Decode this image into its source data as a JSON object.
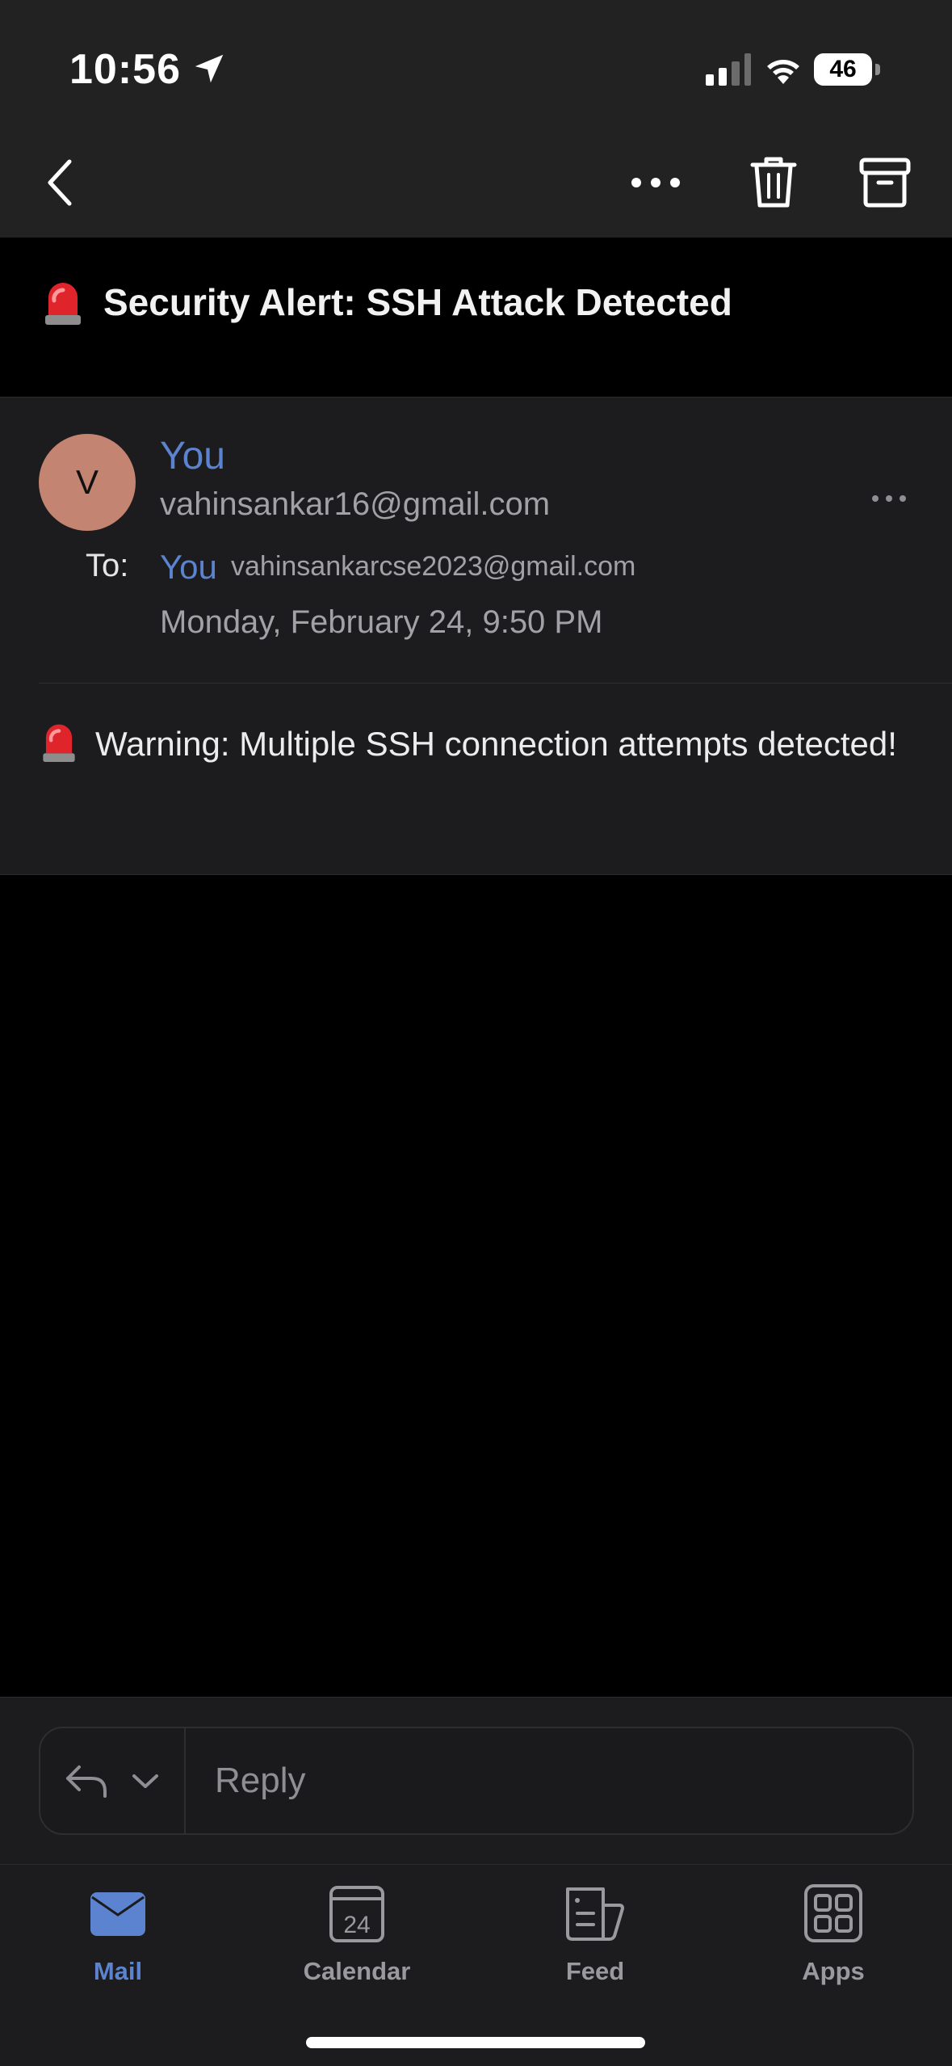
{
  "status_bar": {
    "time": "10:56",
    "battery": "46",
    "location_icon": "location-arrow-icon",
    "signal_icon": "cellular-signal-icon",
    "wifi_icon": "wifi-icon"
  },
  "nav": {
    "back_icon": "chevron-left-icon",
    "more_icon": "ellipsis-icon",
    "delete_icon": "trash-icon",
    "archive_icon": "archive-icon"
  },
  "email": {
    "subject": "Security Alert: SSH Attack Detected",
    "subject_icon": "siren-icon",
    "sender": {
      "avatar_initial": "V",
      "name": "You",
      "email": "vahinsankar16@gmail.com"
    },
    "recipient": {
      "label": "To:",
      "name": "You",
      "email": "vahinsankarcse2023@gmail.com"
    },
    "date": "Monday, February 24, 9:50 PM",
    "body": "Warning: Multiple SSH connection attempts detected!"
  },
  "reply_bar": {
    "placeholder": "Reply",
    "reply_icon": "reply-arrow-icon",
    "dropdown_icon": "chevron-down-icon"
  },
  "tabs": [
    {
      "label": "Mail",
      "icon": "mail-icon",
      "active": true
    },
    {
      "label": "Calendar",
      "icon": "calendar-icon",
      "calendar_day": "24",
      "active": false
    },
    {
      "label": "Feed",
      "icon": "feed-icon",
      "active": false
    },
    {
      "label": "Apps",
      "icon": "apps-grid-icon",
      "active": false
    }
  ],
  "colors": {
    "accent": "#5b83cf",
    "avatar": "#c48472",
    "siren_red": "#e0242b"
  }
}
